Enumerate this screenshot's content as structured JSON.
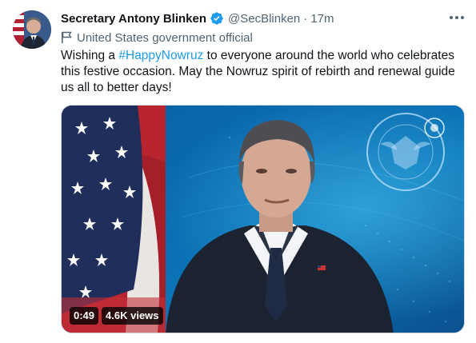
{
  "author": {
    "name": "Secretary Antony Blinken",
    "handle": "@SecBlinken",
    "separator": "·",
    "time": "17m",
    "label": "United States government official"
  },
  "tweet": {
    "text_before": "Wishing a ",
    "hashtag": "#HappyNowruz",
    "text_after": " to everyone around the world who celebrates this festive occasion. May the Nowruz spirit of rebirth and renewal guide us all to better days!"
  },
  "video": {
    "duration": "0:49",
    "views": "4.6K views",
    "seal_text": "DEPARTMENT OF STATE · UNITED STATES OF AMERICA"
  },
  "icons": {
    "verified": "verified-badge-icon",
    "label_flag": "flag-icon",
    "more": "more-options-icon"
  },
  "colors": {
    "link": "#1d9bf0",
    "secondary_text": "#536471",
    "primary_text": "#0f1419"
  }
}
